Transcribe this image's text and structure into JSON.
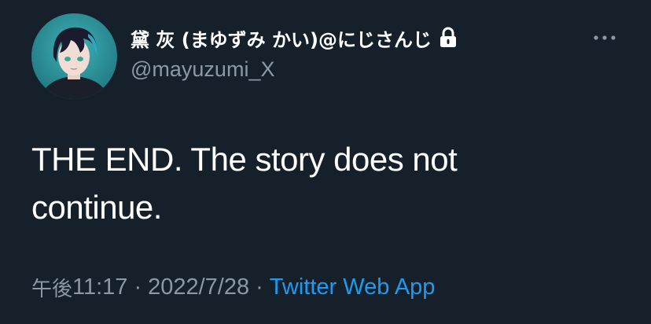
{
  "tweet": {
    "display_name": "黛 灰 (まゆずみ かい)@にじさんじ",
    "handle": "@mayuzumi_X",
    "text": "THE END. The story does not continue.",
    "time_prefix": "午後",
    "time": "11:17",
    "date": "2022/7/28",
    "separator": "·",
    "source": "Twitter Web App",
    "protected_icon": "lock-icon",
    "more_icon": "more-horizontal-icon",
    "avatar_icon": "avatar"
  },
  "colors": {
    "background": "#15202b",
    "primary_text": "#ffffff",
    "secondary_text": "#8b98a5",
    "link": "#1d9bf0"
  }
}
